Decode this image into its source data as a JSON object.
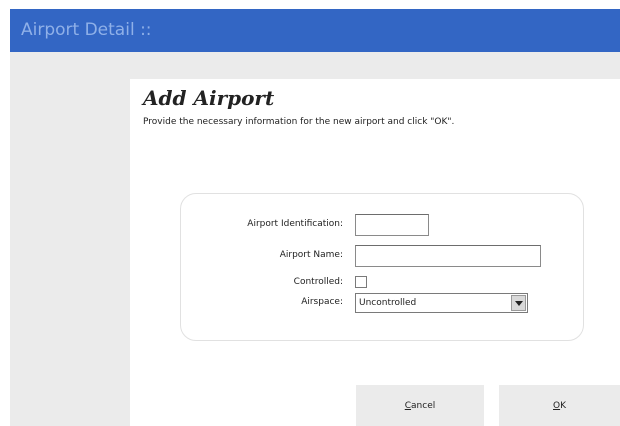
{
  "window": {
    "title": "Airport Detail ::"
  },
  "page": {
    "heading": "Add Airport",
    "instructions": "Provide the necessary information for the new airport and click \"OK\"."
  },
  "form": {
    "airport_identification": {
      "label": "Airport Identification:",
      "value": ""
    },
    "airport_name": {
      "label": "Airport Name:",
      "value": ""
    },
    "controlled": {
      "label": "Controlled:",
      "checked": false
    },
    "airspace": {
      "label": "Airspace:",
      "value": "Uncontrolled"
    }
  },
  "buttons": {
    "cancel": {
      "accel": "C",
      "rest": "ancel"
    },
    "ok": {
      "accel": "O",
      "rest": "K"
    }
  }
}
